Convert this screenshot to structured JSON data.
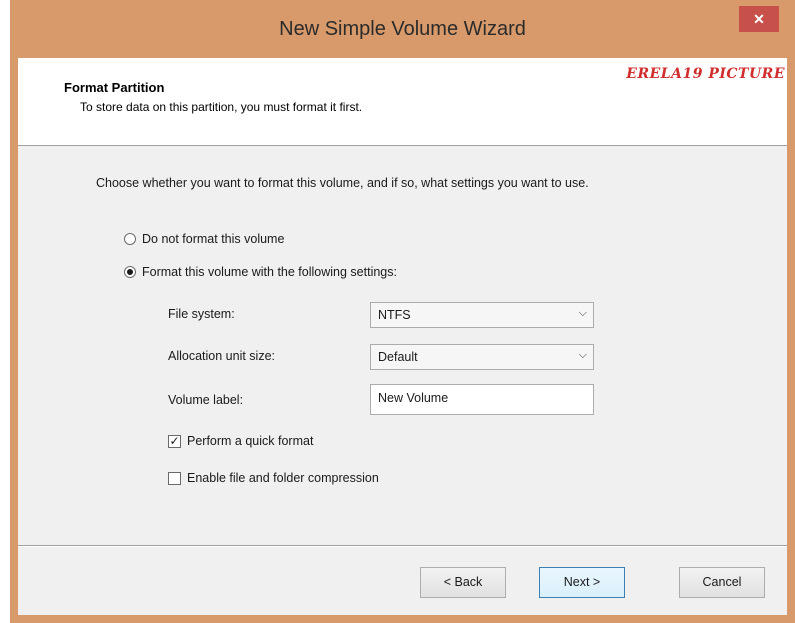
{
  "window": {
    "title": "New Simple Volume Wizard",
    "close_label": "✕"
  },
  "header": {
    "title": "Format Partition",
    "subtitle": "To store data on this partition, you must format it first.",
    "watermark": "ERELA19 PICTURE"
  },
  "main": {
    "instruction": "Choose whether you want to format this volume, and if so, what settings you want to use.",
    "options": [
      {
        "label": "Do not format this volume",
        "selected": false
      },
      {
        "label": "Format this volume with the following settings:",
        "selected": true
      }
    ],
    "fields": {
      "file_system": {
        "label": "File system:",
        "value": "NTFS"
      },
      "allocation_unit": {
        "label": "Allocation unit size:",
        "value": "Default"
      },
      "volume_label": {
        "label": "Volume label:",
        "value": "New Volume"
      }
    },
    "checkboxes": [
      {
        "label": "Perform a quick format",
        "checked": true
      },
      {
        "label": "Enable file and folder compression",
        "checked": false
      }
    ]
  },
  "footer": {
    "back_label": "< Back",
    "next_label": "Next >",
    "cancel_label": "Cancel"
  },
  "colors": {
    "titlebar": "#d89a6a",
    "close_button": "#c7504a",
    "watermark": "#d22d2d",
    "dialog_background": "#f0f0f0"
  }
}
